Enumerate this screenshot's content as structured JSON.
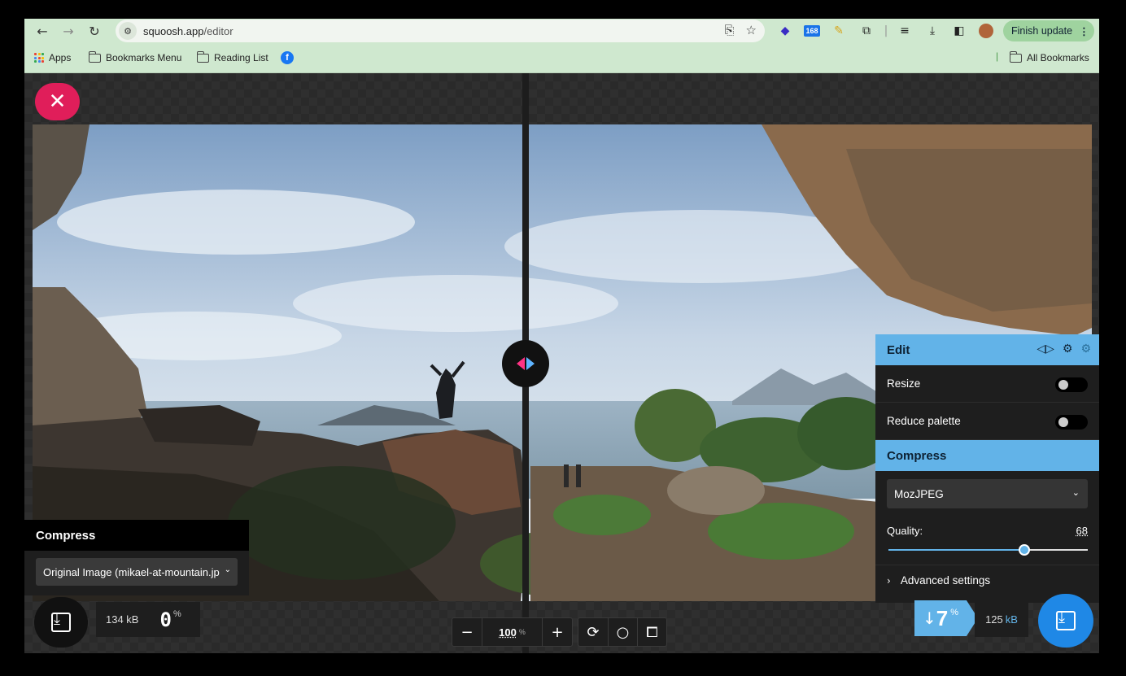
{
  "browser": {
    "url_host": "squoosh.app",
    "url_path": "/editor",
    "finish_update": "Finish update",
    "ext_badge": "168"
  },
  "bookmarks": {
    "apps": "Apps",
    "bookmarks_menu": "Bookmarks Menu",
    "reading_list": "Reading List",
    "all_bookmarks": "All Bookmarks"
  },
  "left": {
    "panel_title": "Compress",
    "select_value": "Original Image (mikael-at-mountain.jp",
    "size": "134 kB",
    "percent": "0",
    "percent_sign": "%"
  },
  "zoom": {
    "value": "100",
    "unit": "%"
  },
  "right": {
    "edit_title": "Edit",
    "resize_label": "Resize",
    "resize_on": false,
    "reduce_palette_label": "Reduce palette",
    "reduce_palette_on": false,
    "compress_title": "Compress",
    "codec": "MozJPEG",
    "quality_label": "Quality:",
    "quality_value": "68",
    "quality_fraction": 0.68,
    "advanced_label": "Advanced settings",
    "reduction_arrow": "↓",
    "reduction": "7",
    "reduction_sign": "%",
    "size_num": "125",
    "size_unit": "kB"
  },
  "colors": {
    "accent_blue": "#62b3e8",
    "close_pink": "#e01e5a",
    "download_blue": "#1f88e6"
  }
}
